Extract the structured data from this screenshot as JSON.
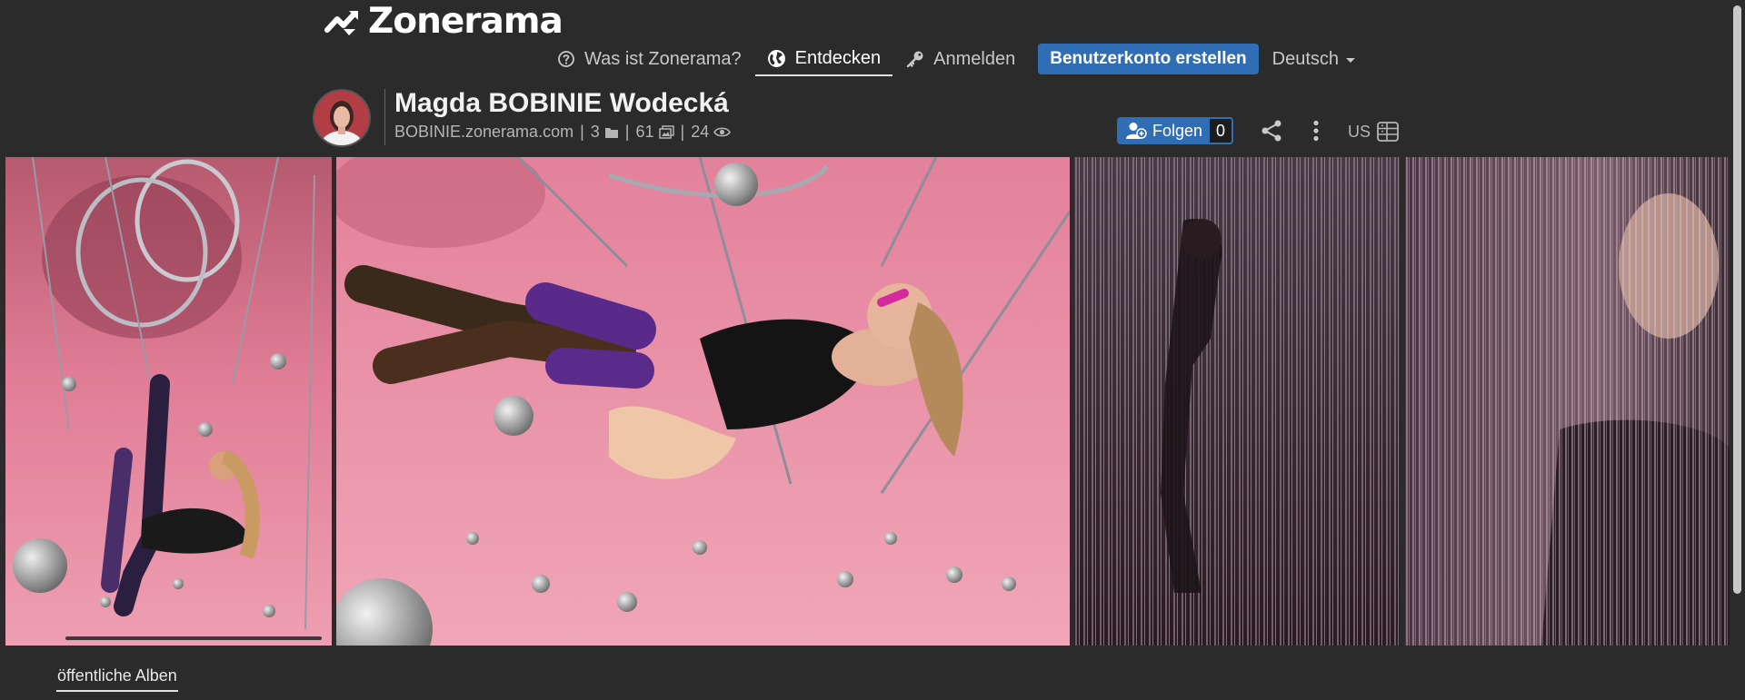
{
  "brand": {
    "logo_text": "Zonerama"
  },
  "nav": {
    "what_is": "Was ist Zonerama?",
    "discover": "Entdecken",
    "login": "Anmelden",
    "signup": "Benutzerkonto erstellen",
    "language": "Deutsch"
  },
  "profile": {
    "name": "Magda BOBINIE Wodecká",
    "domain": "BOBINIE.zonerama.com",
    "albums": "3",
    "photos": "61",
    "views": "24",
    "separator": "|"
  },
  "actions": {
    "follow_label": "Folgen",
    "follow_count": "0",
    "region": "US"
  },
  "tabs": {
    "public_albums": "öffentliche Alben"
  },
  "colors": {
    "background": "#2b2b2b",
    "accent": "#2f6db5",
    "photo_pink": "#e8809a"
  },
  "icons": [
    "logo-icon",
    "question-circle-icon",
    "globe-icon",
    "key-icon",
    "folder-icon",
    "photos-icon",
    "eye-icon",
    "user-plus-icon",
    "share-icon",
    "more-vertical-icon",
    "storage-icon"
  ]
}
